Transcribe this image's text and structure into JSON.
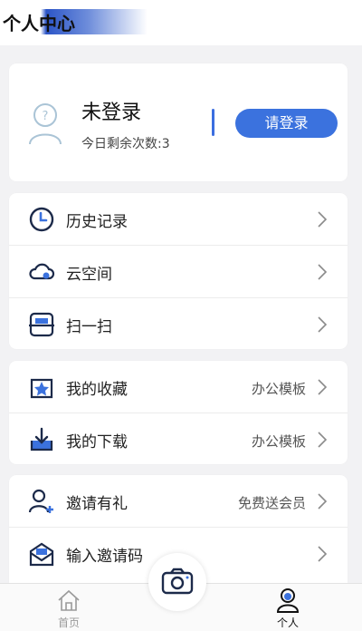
{
  "header": {
    "title": "个人中心"
  },
  "profile": {
    "username": "未登录",
    "remaining": "今日剩余次数:3",
    "login_label": "请登录"
  },
  "menu_group1": [
    {
      "label": "历史记录",
      "icon": "clock-icon"
    },
    {
      "label": "云空间",
      "icon": "cloud-icon"
    },
    {
      "label": "扫一扫",
      "icon": "scan-icon"
    }
  ],
  "menu_group2": [
    {
      "label": "我的收藏",
      "extra": "办公模板",
      "icon": "star-box-icon"
    },
    {
      "label": "我的下载",
      "extra": "办公模板",
      "icon": "download-icon"
    }
  ],
  "menu_group3": [
    {
      "label": "邀请有礼",
      "extra": "免费送会员",
      "icon": "add-user-icon"
    },
    {
      "label": "输入邀请码",
      "icon": "mail-icon"
    }
  ],
  "tabbar": {
    "home_label": "首页",
    "profile_label": "个人"
  },
  "colors": {
    "accent": "#3b72de",
    "icon_dark": "#1c2a4a"
  }
}
